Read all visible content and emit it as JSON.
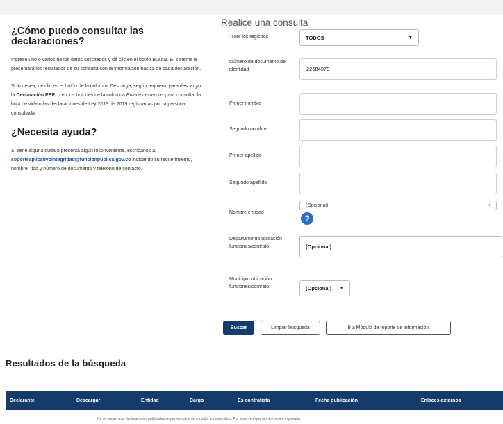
{
  "intro": {
    "title": "¿Cómo puedo consultar las declaraciones?",
    "p1": "Ingrese uno o varios de los datos solicitados y dé clic en el botón Buscar. El sistema le presentará los resultados de su consulta con la información básica de cada declaración.",
    "p2_a": "Si lo desea, dé clic en el botón de la columna ",
    "p2_b": "Descarga",
    "p2_c": ", según requiera, para descargar la ",
    "p2_d": "Declaración PEP",
    "p2_e": ", o en los botones de la columna ",
    "p2_f": "Enlaces externos",
    "p2_g": " para consultar la hoja de vida o las declaraciones de Ley 2013 de 2019 registradas por la persona consultada.",
    "help_title": "¿Necesita ayuda?",
    "help_a": "Si tiene alguna duda o presenta algún inconveniente, escríbanos a: ",
    "help_email": "soporteaplicativointegridad@funcionpublica.gov.co",
    "help_b": " indicando su requerimiento, nombre, tipo y número de documento y teléfono de contacto."
  },
  "form": {
    "title": "Realice una consulta",
    "registros_label": "Traer los registros",
    "registros_value": "TODOS",
    "documento_label": "Número de documento de identidad",
    "documento_value": "22584979",
    "primer_nombre_label": "Primer nombre",
    "segundo_nombre_label": "Segundo nombre",
    "primer_apellido_label": "Primer apellido",
    "segundo_apellido_label": "Segundo apellido",
    "entidad_label": "Nombre entidad",
    "entidad_value": "(Opcional)",
    "departamento_label": "Departamento ubicación funciones/contrato",
    "departamento_value": "(Opcional)",
    "municipio_label": "Municipio ubicación funciones/contrato",
    "municipio_value": "(Opcional)",
    "buscar": "Buscar",
    "limpiar": "Limpiar búsqueda",
    "modulo": "Ir a Módulo de reporte de información"
  },
  "results": {
    "title": "Resultados de la búsqueda",
    "columns": [
      "Declarante",
      "Descargar",
      "Entidad",
      "Cargo",
      "Es contratista",
      "Fecha publicación",
      "Enlaces externos"
    ],
    "empty": "No se encuentran declaraciones publicadas según los datos de consulta suministrados. Por favor verifique la información ingresada."
  }
}
